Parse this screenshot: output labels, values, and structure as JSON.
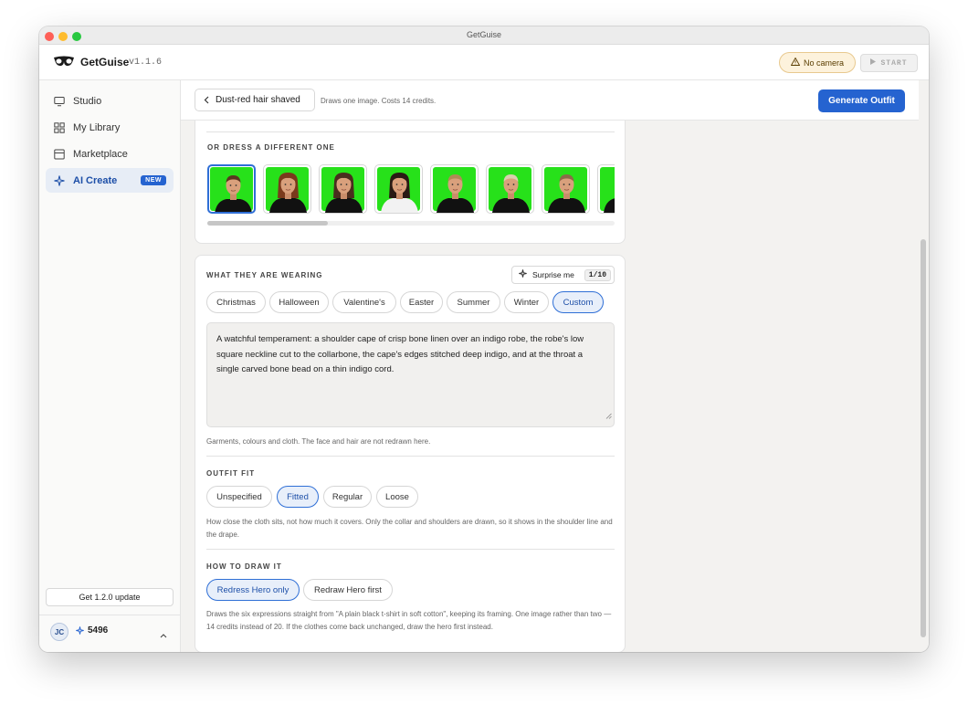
{
  "window": {
    "title": "GetGuise"
  },
  "app": {
    "name": "GetGuise",
    "version": "v1.1.6"
  },
  "header": {
    "camera_status": "No camera",
    "start_label": "START"
  },
  "sidebar": {
    "items": [
      {
        "label": "Studio",
        "icon": "monitor-icon"
      },
      {
        "label": "My Library",
        "icon": "grid-icon"
      },
      {
        "label": "Marketplace",
        "icon": "store-icon"
      },
      {
        "label": "AI Create",
        "icon": "sparkle-icon",
        "badge": "NEW",
        "active": true
      }
    ],
    "update_label": "Get 1.2.0 update",
    "user_initials": "JC",
    "credits": "5496"
  },
  "topbar": {
    "back_label": "Dust-red hair shaved",
    "note": "Draws one image. Costs 14 credits.",
    "generate_label": "Generate Outfit"
  },
  "dress_section": {
    "title": "OR DRESS A DIFFERENT ONE",
    "thumbnails": [
      {
        "hair": "#5a3820",
        "shirt": "#111111",
        "long_hair": false,
        "selected": true
      },
      {
        "hair": "#7a3a1c",
        "shirt": "#111111",
        "long_hair": true,
        "selected": false
      },
      {
        "hair": "#4a2d1e",
        "shirt": "#111111",
        "long_hair": true,
        "selected": false
      },
      {
        "hair": "#2a1a14",
        "shirt": "#f2f2f2",
        "long_hair": true,
        "selected": false
      },
      {
        "hair": "#b08a55",
        "shirt": "#111111",
        "long_hair": false,
        "selected": false
      },
      {
        "hair": "#d9cfae",
        "shirt": "#111111",
        "long_hair": false,
        "selected": false
      },
      {
        "hair": "#8a6c48",
        "shirt": "#111111",
        "long_hair": false,
        "selected": false
      },
      {
        "hair": "#2a1a14",
        "shirt": "#111111",
        "long_hair": false,
        "selected": false
      }
    ]
  },
  "wearing": {
    "title": "WHAT THEY ARE WEARING",
    "surprise_label": "Surprise me",
    "surprise_count": "1/10",
    "presets": [
      "Christmas",
      "Halloween",
      "Valentine's",
      "Easter",
      "Summer",
      "Winter",
      "Custom"
    ],
    "selected_preset": "Custom",
    "description": "A watchful temperament: a shoulder cape of crisp bone linen over an indigo robe, the robe's low square neckline cut to the collarbone, the cape's edges stitched deep indigo, and at the throat a single carved bone bead on a thin indigo cord.",
    "help": "Garments, colours and cloth. The face and hair are not redrawn here."
  },
  "fit": {
    "title": "OUTFIT FIT",
    "options": [
      "Unspecified",
      "Fitted",
      "Regular",
      "Loose"
    ],
    "selected": "Fitted",
    "help": "How close the cloth sits, not how much it covers. Only the collar and shoulders are drawn, so it shows in the shoulder line and the drape."
  },
  "draw": {
    "title": "HOW TO DRAW IT",
    "options": [
      "Redress Hero only",
      "Redraw Hero first"
    ],
    "selected": "Redress Hero only",
    "help": "Draws the six expressions straight from \"A plain black t-shirt in soft cotton\", keeping its framing. One image rather than two — 14 credits instead of 20. If the clothes come back unchanged, draw the hero first instead."
  },
  "colors": {
    "accent": "#2563d0",
    "green_screen": "#27e11a"
  }
}
